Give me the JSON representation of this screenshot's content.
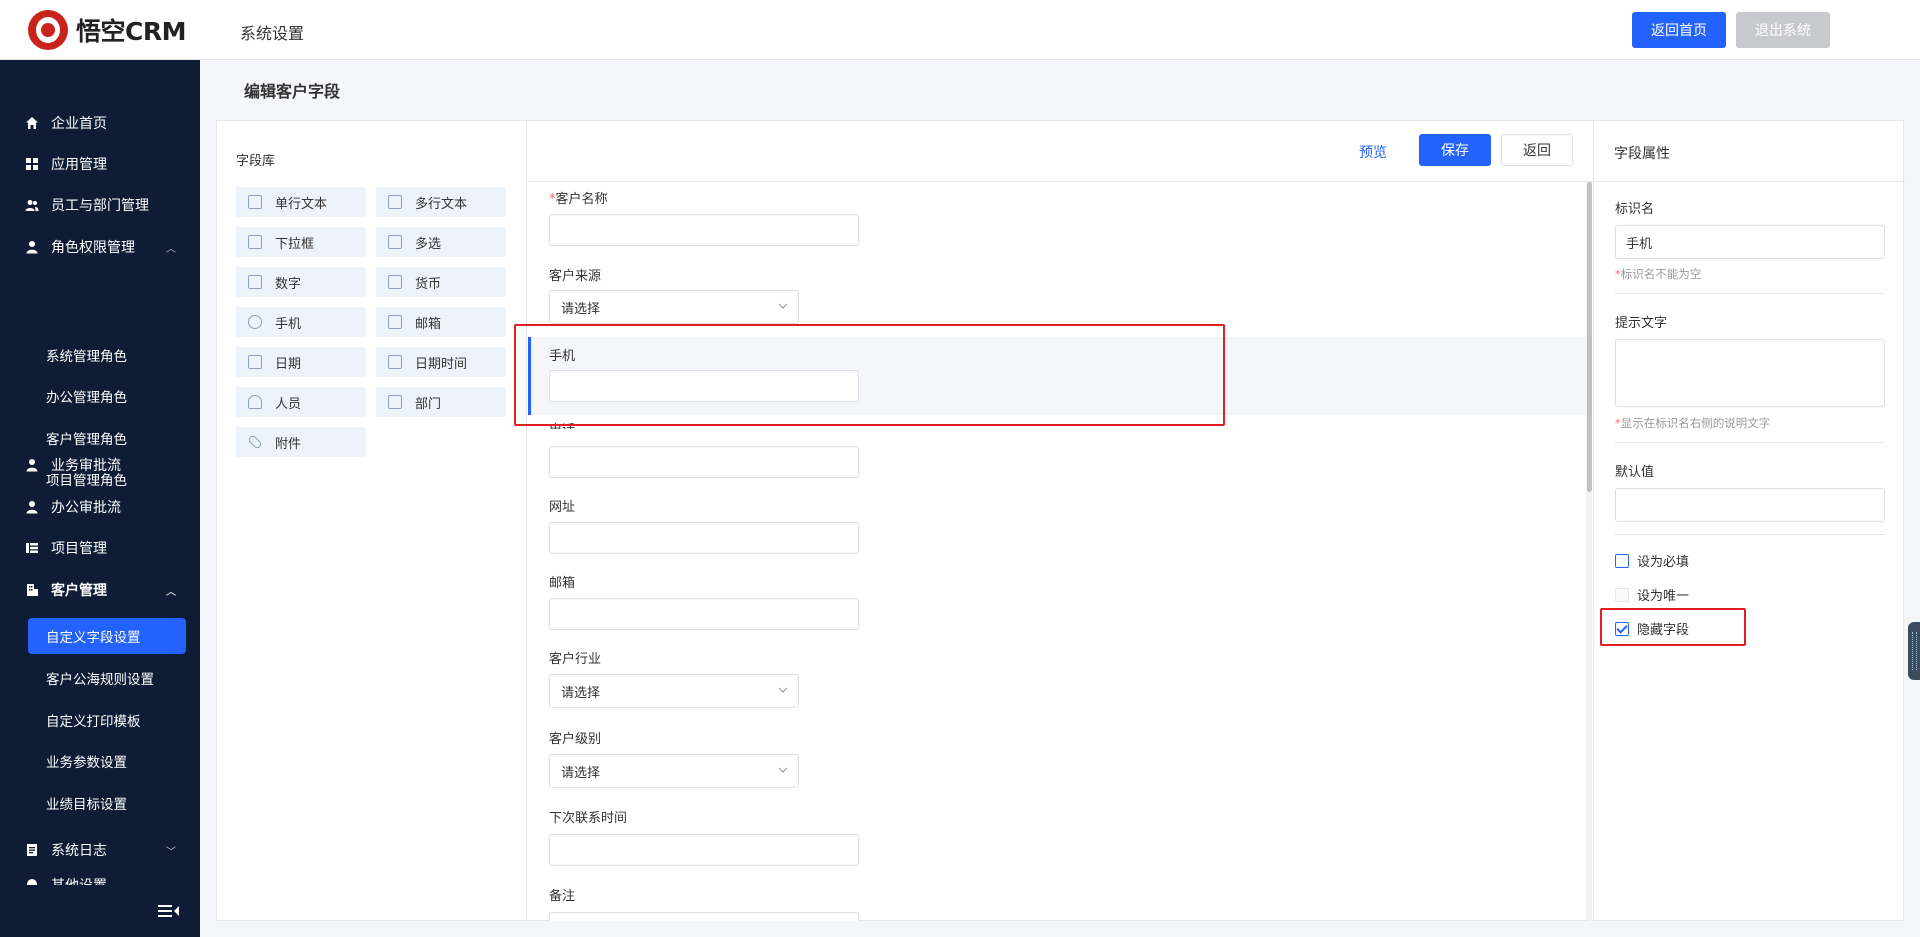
{
  "header": {
    "logo_text": "悟空CRM",
    "title": "系统设置",
    "home_button": "返回首页",
    "exit_button": "退出系统"
  },
  "sidebar": {
    "items": [
      {
        "label": "企业首页",
        "icon": "home-icon"
      },
      {
        "label": "应用管理",
        "icon": "grid-icon"
      },
      {
        "label": "员工与部门管理",
        "icon": "users-icon"
      },
      {
        "label": "角色权限管理",
        "icon": "user-icon",
        "expanded": true
      },
      {
        "label": "系统管理角色"
      },
      {
        "label": "办公管理角色"
      },
      {
        "label": "客户管理角色"
      },
      {
        "label": "项目管理角色"
      },
      {
        "label": "业务审批流",
        "icon": "user-icon"
      },
      {
        "label": "办公审批流",
        "icon": "user-icon"
      },
      {
        "label": "项目管理",
        "icon": "list-icon"
      },
      {
        "label": "客户管理",
        "icon": "building-icon",
        "expanded": true
      },
      {
        "label": "自定义字段设置",
        "active": true
      },
      {
        "label": "客户公海规则设置"
      },
      {
        "label": "自定义打印模板"
      },
      {
        "label": "业务参数设置"
      },
      {
        "label": "业绩目标设置"
      },
      {
        "label": "系统日志",
        "icon": "log-icon",
        "expanded": false
      },
      {
        "label": "其他设置",
        "icon": "gear-icon"
      }
    ]
  },
  "page": {
    "heading": "编辑客户字段"
  },
  "library": {
    "title": "字段库",
    "items": [
      {
        "label": "单行文本",
        "icon": "single-text-icon"
      },
      {
        "label": "多行文本",
        "icon": "multi-text-icon"
      },
      {
        "label": "下拉框",
        "icon": "dropdown-icon"
      },
      {
        "label": "多选",
        "icon": "checkbox-icon"
      },
      {
        "label": "数字",
        "icon": "number-icon"
      },
      {
        "label": "货币",
        "icon": "currency-icon"
      },
      {
        "label": "手机",
        "icon": "phone-icon"
      },
      {
        "label": "邮箱",
        "icon": "mail-icon"
      },
      {
        "label": "日期",
        "icon": "date-icon"
      },
      {
        "label": "日期时间",
        "icon": "datetime-icon"
      },
      {
        "label": "人员",
        "icon": "person-icon"
      },
      {
        "label": "部门",
        "icon": "department-icon"
      },
      {
        "label": "附件",
        "icon": "attachment-icon"
      }
    ]
  },
  "toolbar": {
    "preview": "预览",
    "save": "保存",
    "back": "返回"
  },
  "form": {
    "fields": [
      {
        "label": "客户名称",
        "required": true,
        "type": "input"
      },
      {
        "label": "客户来源",
        "type": "select",
        "value": "请选择"
      },
      {
        "label": "手机",
        "type": "input",
        "selected": true
      },
      {
        "label": "电话",
        "type": "input"
      },
      {
        "label": "网址",
        "type": "input"
      },
      {
        "label": "邮箱",
        "type": "input"
      },
      {
        "label": "客户行业",
        "type": "select",
        "value": "请选择"
      },
      {
        "label": "客户级别",
        "type": "select",
        "value": "请选择"
      },
      {
        "label": "下次联系时间",
        "type": "input"
      },
      {
        "label": "备注",
        "type": "input"
      }
    ]
  },
  "props": {
    "title": "字段属性",
    "name_label": "标识名",
    "name_value": "手机",
    "name_hint": "标识名不能为空",
    "tip_label": "提示文字",
    "tip_hint": "显示在标识名右侧的说明文字",
    "default_label": "默认值",
    "required_label": "设为必填",
    "unique_label": "设为唯一",
    "hidden_label": "隐藏字段",
    "required_checked": false,
    "unique_disabled": true,
    "hidden_checked": true
  },
  "colors": {
    "primary": "#2362fb",
    "sidebar_bg": "#0e1c35",
    "highlight": "#e02020"
  }
}
